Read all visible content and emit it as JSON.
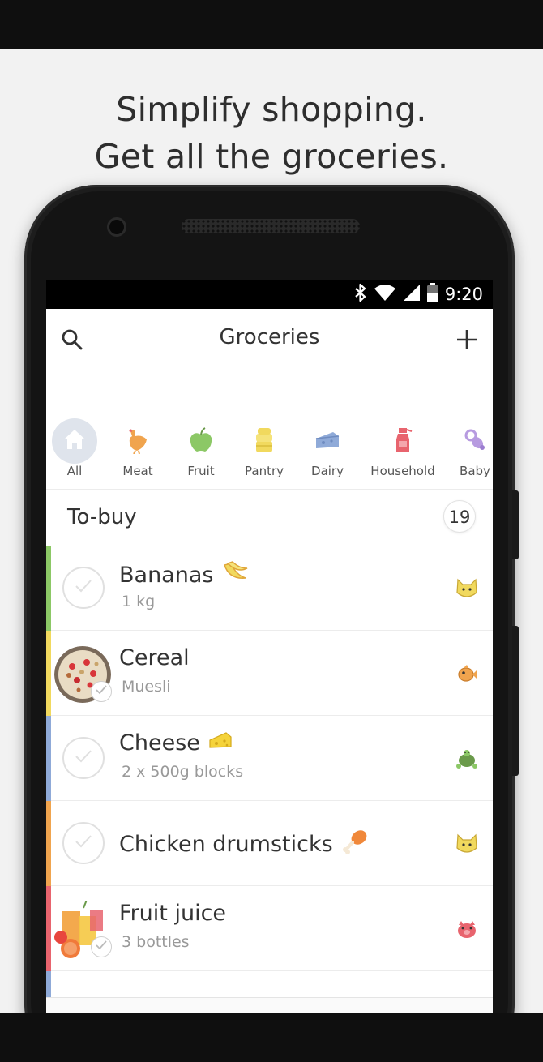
{
  "headline": {
    "line1": "Simplify shopping.",
    "line2": "Get all the groceries."
  },
  "status_bar": {
    "time": "9:20",
    "icons": [
      "bluetooth-icon",
      "wifi-icon",
      "signal-icon",
      "battery-icon"
    ]
  },
  "app_bar": {
    "title": "Groceries",
    "left_icon": "search-icon",
    "right_icon": "plus-icon"
  },
  "categories": [
    {
      "label": "All",
      "icon": "home-icon",
      "selected": true
    },
    {
      "label": "Meat",
      "icon": "chicken-icon"
    },
    {
      "label": "Fruit",
      "icon": "apple-icon"
    },
    {
      "label": "Pantry",
      "icon": "cans-icon"
    },
    {
      "label": "Dairy",
      "icon": "cheese-icon"
    },
    {
      "label": "Household",
      "icon": "spray-bottle-icon"
    },
    {
      "label": "Baby",
      "icon": "pacifier-icon"
    }
  ],
  "section": {
    "title": "To-buy",
    "count": "19"
  },
  "items": [
    {
      "name": "Bananas",
      "detail": "1 kg",
      "emoji": "🍌",
      "assignee": "cat-avatar-icon",
      "stripe": "#8cc866",
      "has_photo": false
    },
    {
      "name": "Cereal",
      "detail": "Muesli",
      "emoji": "",
      "assignee": "fish-avatar-icon",
      "stripe": "#f1d95e",
      "has_photo": true
    },
    {
      "name": "Cheese",
      "detail": "2 x 500g blocks",
      "emoji": "🧀",
      "assignee": "turtle-avatar-icon",
      "stripe": "#8faad8",
      "has_photo": false
    },
    {
      "name": "Chicken drumsticks",
      "detail": "",
      "emoji": "🍗",
      "assignee": "cat-avatar-icon",
      "stripe": "#f0a44e",
      "has_photo": false
    },
    {
      "name": "Fruit juice",
      "detail": "3 bottles",
      "emoji": "",
      "assignee": "pig-avatar-icon",
      "stripe": "#e8646e",
      "has_photo": true
    }
  ]
}
